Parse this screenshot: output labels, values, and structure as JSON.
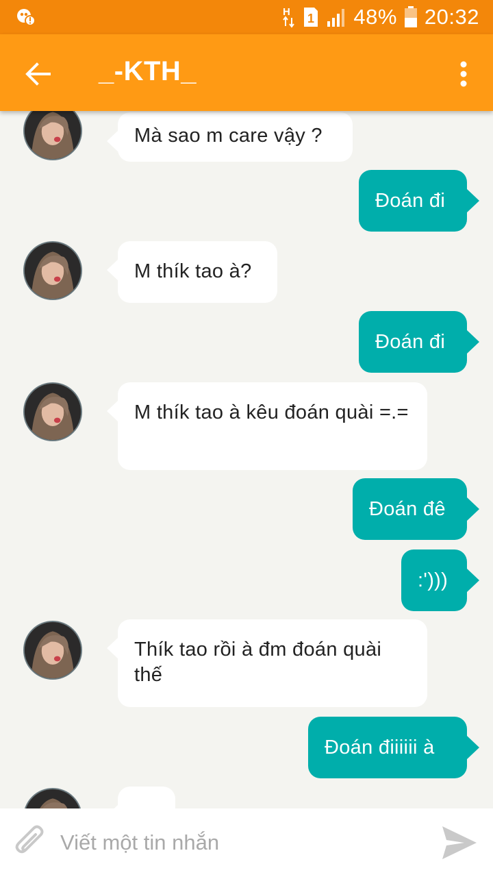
{
  "status_bar": {
    "notification_icon": "game-notification-icon",
    "network_type": "H",
    "sim_slot": "1",
    "battery_percent": "48%",
    "time": "20:32",
    "colors": {
      "background": "#f3870a",
      "text": "#ffffff"
    }
  },
  "header": {
    "back_icon": "arrow-left-icon",
    "title": "_-KTH_",
    "menu_icon": "more-vert-icon",
    "colors": {
      "background": "#ff9a14"
    }
  },
  "messages": [
    {
      "from": "them",
      "text": "Mà sao m care vậy ?"
    },
    {
      "from": "me",
      "text": "Đoán đi"
    },
    {
      "from": "them",
      "text": "M thík tao à?"
    },
    {
      "from": "me",
      "text": "Đoán đi"
    },
    {
      "from": "them",
      "text": "M thík tao à kêu đoán quài =.="
    },
    {
      "from": "me",
      "text": "Đoán đê"
    },
    {
      "from": "me",
      "text": ":')))"
    },
    {
      "from": "them",
      "text": "Thík tao rồi à đm đoán quài thế"
    },
    {
      "from": "me",
      "text": "Đoán điiiiii à"
    },
    {
      "from": "them",
      "text": ""
    }
  ],
  "composer": {
    "attach_icon": "paperclip-icon",
    "placeholder": "Viết một tin nhắn",
    "value": "",
    "send_icon": "send-icon"
  },
  "colors": {
    "incoming_bubble": "#ffffff",
    "outgoing_bubble": "#00aeab",
    "chat_background": "#f4f4f0"
  }
}
